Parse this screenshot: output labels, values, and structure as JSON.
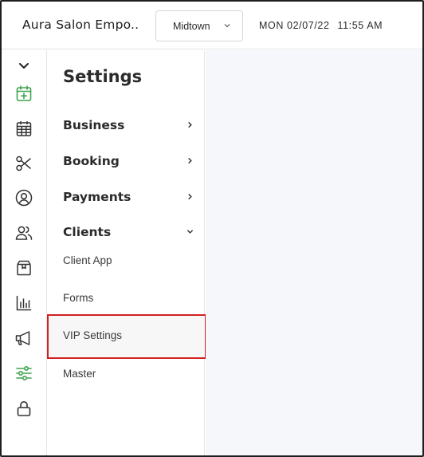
{
  "header": {
    "title": "Aura Salon Empo..",
    "location": "Midtown",
    "date": "MON 02/07/22",
    "time": "11:55 AM"
  },
  "rail": {
    "items": [
      {
        "icon": "collapse-chevron-icon"
      },
      {
        "icon": "calendar-add-icon",
        "active": true,
        "color": "#3fa34d"
      },
      {
        "icon": "calendar-grid-icon"
      },
      {
        "icon": "scissors-icon"
      },
      {
        "icon": "user-circle-icon"
      },
      {
        "icon": "users-icon"
      },
      {
        "icon": "box-icon"
      },
      {
        "icon": "bar-chart-icon"
      },
      {
        "icon": "megaphone-icon"
      },
      {
        "icon": "sliders-icon",
        "active": true,
        "color": "#3fa34d"
      },
      {
        "icon": "lock-icon"
      }
    ]
  },
  "settings": {
    "title": "Settings",
    "sections": [
      {
        "label": "Business",
        "expanded": false
      },
      {
        "label": "Booking",
        "expanded": false
      },
      {
        "label": "Payments",
        "expanded": false
      },
      {
        "label": "Clients",
        "expanded": true
      }
    ],
    "client_items": [
      {
        "label": "Client App"
      },
      {
        "label": "Forms"
      },
      {
        "label": "VIP Settings",
        "selected": true
      },
      {
        "label": "Master"
      }
    ]
  },
  "colors": {
    "accent_green": "#3fa34d",
    "highlight_red": "#d32020",
    "content_bg": "#f6f7fb"
  }
}
